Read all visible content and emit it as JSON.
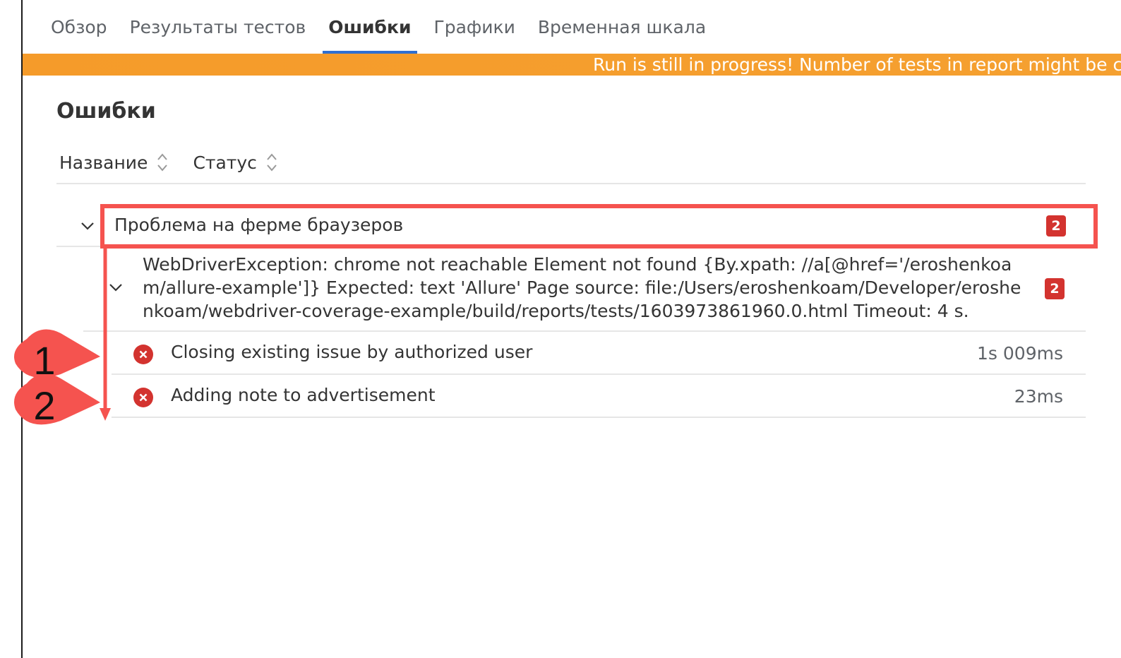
{
  "tabs": [
    {
      "label": "Обзор",
      "active": false
    },
    {
      "label": "Результаты тестов",
      "active": false
    },
    {
      "label": "Ошибки",
      "active": true
    },
    {
      "label": "Графики",
      "active": false
    },
    {
      "label": "Временная шкала",
      "active": false
    }
  ],
  "banner": {
    "text": "Run is still in progress! Number of tests in report might be cl"
  },
  "page": {
    "title": "Ошибки"
  },
  "columns": {
    "name": "Название",
    "status": "Статус"
  },
  "group": {
    "label": "Проблема на ферме браузеров",
    "count": "2",
    "message": {
      "text": "WebDriverException: chrome not reachable Element not found {By.xpath: //a[@href='/eroshenkoam/allure-example']} Expected: text 'Allure' Page source: file:/Users/eroshenkoam/Developer/eroshenkoam/webdriver-coverage-example/build/reports/tests/1603973861960.0.html Timeout: 4 s.",
      "count": "2",
      "tests": [
        {
          "name": "Closing existing issue by authorized user",
          "duration": "1s 009ms",
          "status": "failed"
        },
        {
          "name": "Adding note to advertisement",
          "duration": "23ms",
          "status": "failed"
        }
      ]
    }
  },
  "annotations": {
    "callout_1": "1",
    "callout_2": "2"
  },
  "colors": {
    "accent": "#2f6fd1",
    "banner": "#f59b2a",
    "failed": "#d3332f",
    "highlight": "#f5534f"
  }
}
